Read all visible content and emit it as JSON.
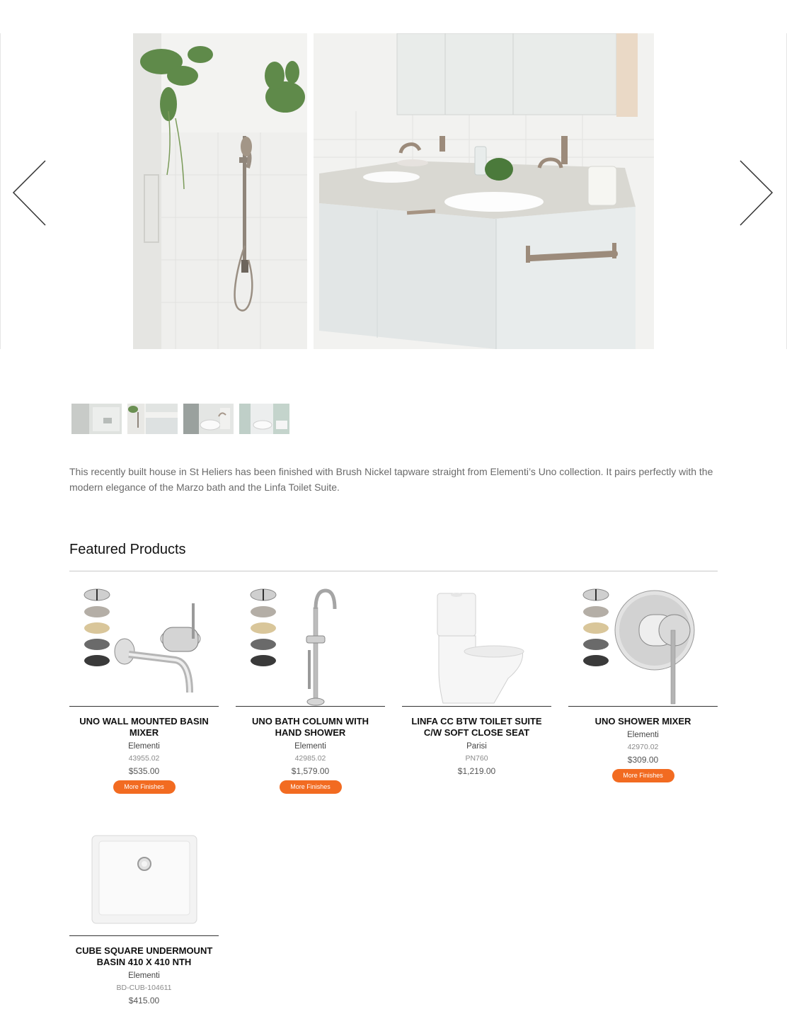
{
  "carousel": {
    "prev_label": "Previous",
    "next_label": "Next",
    "slides": [
      "shower-rail",
      "double-vanity"
    ],
    "thumbnails": [
      "thumb-1",
      "thumb-2",
      "thumb-3",
      "thumb-4"
    ]
  },
  "description": "This recently built house in St Heliers has been finished with Brush Nickel tapware straight from Elementi’s Uno collection. It pairs perfectly with the modern elegance of the Marzo bath and the Linfa Toilet Suite.",
  "featured": {
    "title": "Featured Products",
    "products": [
      {
        "name": "UNO WALL MOUNTED BASIN MIXER",
        "brand": "Elementi",
        "code": "43955.02",
        "price": "$535.00",
        "button": "More Finishes"
      },
      {
        "name": "UNO BATH COLUMN WITH HAND SHOWER",
        "brand": "Elementi",
        "code": "42985.02",
        "price": "$1,579.00",
        "button": "More Finishes"
      },
      {
        "name": "LINFA CC BTW TOILET SUITE C/W SOFT CLOSE SEAT",
        "brand": "Parisi",
        "code": "PN760",
        "price": "$1,219.00"
      },
      {
        "name": "UNO SHOWER MIXER",
        "brand": "Elementi",
        "code": "42970.02",
        "price": "$309.00",
        "button": "More Finishes"
      },
      {
        "name": "CUBE SQUARE UNDERMOUNT BASIN 410 X 410 NTH",
        "brand": "Elementi",
        "code": "BD-CUB-104611",
        "price": "$415.00"
      }
    ]
  },
  "colors": {
    "accent_button": "#f26b21",
    "rule": "#c8c8c8",
    "swatch_chrome": "#d8d8d8",
    "swatch_nickel": "#b4aea6",
    "swatch_brass": "#d9c69a",
    "swatch_gunmetal": "#6a6a6a",
    "swatch_black": "#3a3a3a"
  }
}
